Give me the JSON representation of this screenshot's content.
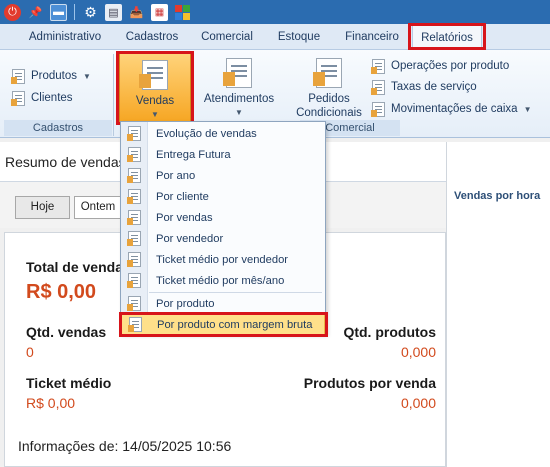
{
  "quick_access": {
    "icons": [
      "power-icon",
      "pin-icon",
      "minimize-icon",
      "gear-icon",
      "document-stack-icon",
      "tray-icon",
      "calendar-icon",
      "windows-tiles-icon"
    ]
  },
  "tabs": [
    {
      "label": "Administrativo"
    },
    {
      "label": "Cadastros"
    },
    {
      "label": "Comercial"
    },
    {
      "label": "Estoque"
    },
    {
      "label": "Financeiro"
    },
    {
      "label": "Relatórios",
      "active": true
    }
  ],
  "ribbon": {
    "cadastros_group": {
      "label": "Cadastros",
      "produtos": "Produtos",
      "clientes": "Clientes"
    },
    "comercial_group": {
      "label": "Comercial",
      "vendas": "Vendas",
      "atendimentos": "Atendimentos",
      "pedidos_line1": "Pedidos",
      "pedidos_line2": "Condicionais",
      "operacoes": "Operações por produto",
      "taxas": "Taxas de serviço",
      "movimentacoes": "Movimentações de caixa"
    }
  },
  "dropdown": {
    "items": [
      "Evolução de vendas",
      "Entrega Futura",
      "Por ano",
      "Por cliente",
      "Por vendas",
      "Por vendedor",
      "Ticket médio por vendedor",
      "Ticket médio por mês/ano",
      "Por produto",
      "Por produto com margem bruta"
    ],
    "selected_index": 9
  },
  "main": {
    "title": "Resumo de vendas",
    "filters": {
      "hoje": "Hoje",
      "ontem": "Ontem"
    },
    "total_label": "Total de vendas",
    "total_value": "R$ 0,00",
    "qtd_vendas_label": "Qtd. vendas",
    "qtd_vendas_value": "0",
    "qtd_produtos_label": "Qtd. produtos",
    "qtd_produtos_value": "0,000",
    "ticket_label": "Ticket médio",
    "ticket_value": "R$ 0,00",
    "produtos_venda_label": "Produtos por venda",
    "produtos_venda_value": "0,000",
    "info": "Informações de: 14/05/2025 10:56"
  },
  "side_panel": {
    "title": "Vendas por hora"
  },
  "colors": {
    "highlight": "#d7141a",
    "value": "#d24a1d",
    "accent": "#2b6cb0"
  }
}
